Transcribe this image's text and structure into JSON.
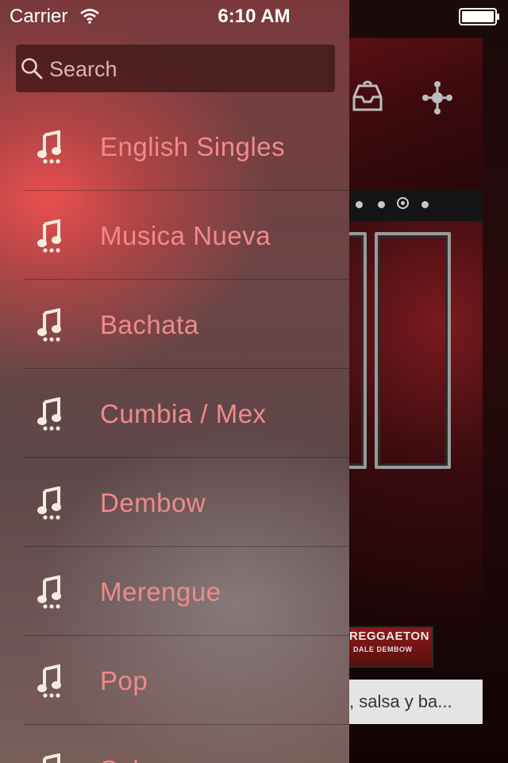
{
  "status_bar": {
    "carrier": "Carrier",
    "time": "6:10 AM"
  },
  "search": {
    "placeholder": "Search"
  },
  "menu": {
    "items": [
      {
        "label": "English Singles",
        "icon": "music-note-icon"
      },
      {
        "label": "Musica Nueva",
        "icon": "music-note-icon"
      },
      {
        "label": "Bachata",
        "icon": "music-note-icon"
      },
      {
        "label": "Cumbia / Mex",
        "icon": "music-note-icon"
      },
      {
        "label": "Dembow",
        "icon": "music-note-icon"
      },
      {
        "label": "Merengue",
        "icon": "music-note-icon"
      },
      {
        "label": "Pop",
        "icon": "music-note-icon"
      },
      {
        "label": "Salsa",
        "icon": "music-note-icon"
      }
    ]
  },
  "background": {
    "logo_title": "REGGAETON",
    "logo_subtitle": "DALE DEMBOW",
    "caption_text": ", salsa y ba..."
  },
  "colors": {
    "menu_label": "#f08a8a",
    "menu_accent": "#f04a4a"
  }
}
